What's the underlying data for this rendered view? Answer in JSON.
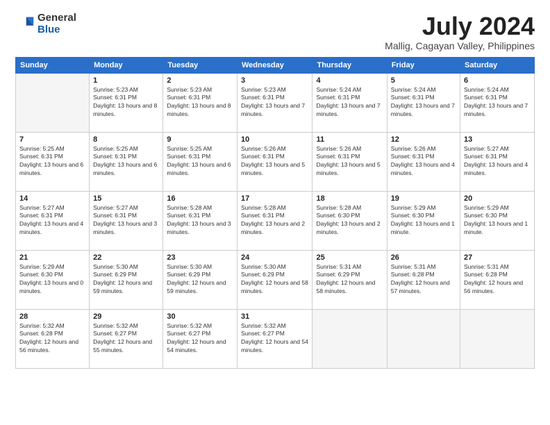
{
  "header": {
    "logo_general": "General",
    "logo_blue": "Blue",
    "month_title": "July 2024",
    "location": "Mallig, Cagayan Valley, Philippines"
  },
  "weekdays": [
    "Sunday",
    "Monday",
    "Tuesday",
    "Wednesday",
    "Thursday",
    "Friday",
    "Saturday"
  ],
  "weeks": [
    [
      {
        "day": "",
        "empty": true
      },
      {
        "day": "1",
        "sunrise": "5:23 AM",
        "sunset": "6:31 PM",
        "daylight": "13 hours and 8 minutes."
      },
      {
        "day": "2",
        "sunrise": "5:23 AM",
        "sunset": "6:31 PM",
        "daylight": "13 hours and 8 minutes."
      },
      {
        "day": "3",
        "sunrise": "5:23 AM",
        "sunset": "6:31 PM",
        "daylight": "13 hours and 7 minutes."
      },
      {
        "day": "4",
        "sunrise": "5:24 AM",
        "sunset": "6:31 PM",
        "daylight": "13 hours and 7 minutes."
      },
      {
        "day": "5",
        "sunrise": "5:24 AM",
        "sunset": "6:31 PM",
        "daylight": "13 hours and 7 minutes."
      },
      {
        "day": "6",
        "sunrise": "5:24 AM",
        "sunset": "6:31 PM",
        "daylight": "13 hours and 7 minutes."
      }
    ],
    [
      {
        "day": "7",
        "sunrise": "5:25 AM",
        "sunset": "6:31 PM",
        "daylight": "13 hours and 6 minutes."
      },
      {
        "day": "8",
        "sunrise": "5:25 AM",
        "sunset": "6:31 PM",
        "daylight": "13 hours and 6 minutes."
      },
      {
        "day": "9",
        "sunrise": "5:25 AM",
        "sunset": "6:31 PM",
        "daylight": "13 hours and 6 minutes."
      },
      {
        "day": "10",
        "sunrise": "5:26 AM",
        "sunset": "6:31 PM",
        "daylight": "13 hours and 5 minutes."
      },
      {
        "day": "11",
        "sunrise": "5:26 AM",
        "sunset": "6:31 PM",
        "daylight": "13 hours and 5 minutes."
      },
      {
        "day": "12",
        "sunrise": "5:26 AM",
        "sunset": "6:31 PM",
        "daylight": "13 hours and 4 minutes."
      },
      {
        "day": "13",
        "sunrise": "5:27 AM",
        "sunset": "6:31 PM",
        "daylight": "13 hours and 4 minutes."
      }
    ],
    [
      {
        "day": "14",
        "sunrise": "5:27 AM",
        "sunset": "6:31 PM",
        "daylight": "13 hours and 4 minutes."
      },
      {
        "day": "15",
        "sunrise": "5:27 AM",
        "sunset": "6:31 PM",
        "daylight": "13 hours and 3 minutes."
      },
      {
        "day": "16",
        "sunrise": "5:28 AM",
        "sunset": "6:31 PM",
        "daylight": "13 hours and 3 minutes."
      },
      {
        "day": "17",
        "sunrise": "5:28 AM",
        "sunset": "6:31 PM",
        "daylight": "13 hours and 2 minutes."
      },
      {
        "day": "18",
        "sunrise": "5:28 AM",
        "sunset": "6:30 PM",
        "daylight": "13 hours and 2 minutes."
      },
      {
        "day": "19",
        "sunrise": "5:29 AM",
        "sunset": "6:30 PM",
        "daylight": "13 hours and 1 minute."
      },
      {
        "day": "20",
        "sunrise": "5:29 AM",
        "sunset": "6:30 PM",
        "daylight": "13 hours and 1 minute."
      }
    ],
    [
      {
        "day": "21",
        "sunrise": "5:29 AM",
        "sunset": "6:30 PM",
        "daylight": "13 hours and 0 minutes."
      },
      {
        "day": "22",
        "sunrise": "5:30 AM",
        "sunset": "6:29 PM",
        "daylight": "12 hours and 59 minutes."
      },
      {
        "day": "23",
        "sunrise": "5:30 AM",
        "sunset": "6:29 PM",
        "daylight": "12 hours and 59 minutes."
      },
      {
        "day": "24",
        "sunrise": "5:30 AM",
        "sunset": "6:29 PM",
        "daylight": "12 hours and 58 minutes."
      },
      {
        "day": "25",
        "sunrise": "5:31 AM",
        "sunset": "6:29 PM",
        "daylight": "12 hours and 58 minutes."
      },
      {
        "day": "26",
        "sunrise": "5:31 AM",
        "sunset": "6:28 PM",
        "daylight": "12 hours and 57 minutes."
      },
      {
        "day": "27",
        "sunrise": "5:31 AM",
        "sunset": "6:28 PM",
        "daylight": "12 hours and 56 minutes."
      }
    ],
    [
      {
        "day": "28",
        "sunrise": "5:32 AM",
        "sunset": "6:28 PM",
        "daylight": "12 hours and 56 minutes."
      },
      {
        "day": "29",
        "sunrise": "5:32 AM",
        "sunset": "6:27 PM",
        "daylight": "12 hours and 55 minutes."
      },
      {
        "day": "30",
        "sunrise": "5:32 AM",
        "sunset": "6:27 PM",
        "daylight": "12 hours and 54 minutes."
      },
      {
        "day": "31",
        "sunrise": "5:32 AM",
        "sunset": "6:27 PM",
        "daylight": "12 hours and 54 minutes."
      },
      {
        "day": "",
        "empty": true
      },
      {
        "day": "",
        "empty": true
      },
      {
        "day": "",
        "empty": true
      }
    ]
  ]
}
